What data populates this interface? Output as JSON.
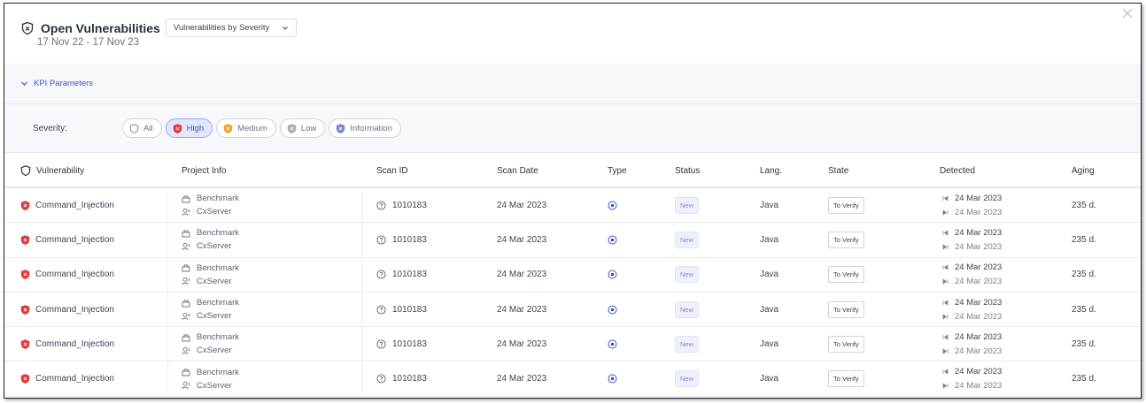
{
  "header": {
    "title": "Open Vulnerabilities",
    "report_select": "Vulnerabilities by Severity",
    "date_range": "17 Nov 22 - 17 Nov 23"
  },
  "kpi": {
    "label": "KPI Parameters"
  },
  "severity_filter": {
    "label": "Severity:",
    "chips": [
      {
        "label": "All",
        "active": false,
        "icon": "shield-outline-icon",
        "color": "#8a909a"
      },
      {
        "label": "High",
        "active": true,
        "icon": "high-severity-icon",
        "color": "#e23b3b"
      },
      {
        "label": "Medium",
        "active": false,
        "icon": "medium-severity-icon",
        "color": "#f2a33a"
      },
      {
        "label": "Low",
        "active": false,
        "icon": "low-severity-icon",
        "color": "#a8adb6"
      },
      {
        "label": "Information",
        "active": false,
        "icon": "info-severity-icon",
        "color": "#7b86c9"
      }
    ]
  },
  "table": {
    "columns": [
      "Vulnerability",
      "Project Info",
      "Scan ID",
      "Scan Date",
      "Type",
      "Status",
      "Lang.",
      "State",
      "Detected",
      "Aging"
    ],
    "rows": [
      {
        "vulnerability": "Command_Injection",
        "project": "Benchmark",
        "owner": "CxServer",
        "scan_id": "1010183",
        "scan_date": "24 Mar 2023",
        "status": "New",
        "lang": "Java",
        "state": "To Verify",
        "first_detected": "24 Mar 2023",
        "last_detected": "24 Mar 2023",
        "aging": "235 d."
      },
      {
        "vulnerability": "Command_Injection",
        "project": "Benchmark",
        "owner": "CxServer",
        "scan_id": "1010183",
        "scan_date": "24 Mar 2023",
        "status": "New",
        "lang": "Java",
        "state": "To Verify",
        "first_detected": "24 Mar 2023",
        "last_detected": "24 Mar 2023",
        "aging": "235 d."
      },
      {
        "vulnerability": "Command_Injection",
        "project": "Benchmark",
        "owner": "CxServer",
        "scan_id": "1010183",
        "scan_date": "24 Mar 2023",
        "status": "New",
        "lang": "Java",
        "state": "To Verify",
        "first_detected": "24 Mar 2023",
        "last_detected": "24 Mar 2023",
        "aging": "235 d."
      },
      {
        "vulnerability": "Command_Injection",
        "project": "Benchmark",
        "owner": "CxServer",
        "scan_id": "1010183",
        "scan_date": "24 Mar 2023",
        "status": "New",
        "lang": "Java",
        "state": "To Verify",
        "first_detected": "24 Mar 2023",
        "last_detected": "24 Mar 2023",
        "aging": "235 d."
      },
      {
        "vulnerability": "Command_Injection",
        "project": "Benchmark",
        "owner": "CxServer",
        "scan_id": "1010183",
        "scan_date": "24 Mar 2023",
        "status": "New",
        "lang": "Java",
        "state": "To Verify",
        "first_detected": "24 Mar 2023",
        "last_detected": "24 Mar 2023",
        "aging": "235 d."
      },
      {
        "vulnerability": "Command_Injection",
        "project": "Benchmark",
        "owner": "CxServer",
        "scan_id": "1010183",
        "scan_date": "24 Mar 2023",
        "status": "New",
        "lang": "Java",
        "state": "To Verify",
        "first_detected": "24 Mar 2023",
        "last_detected": "24 Mar 2023",
        "aging": "235 d."
      }
    ]
  },
  "colors": {
    "accent": "#3a55c5",
    "high": "#e23b3b"
  }
}
